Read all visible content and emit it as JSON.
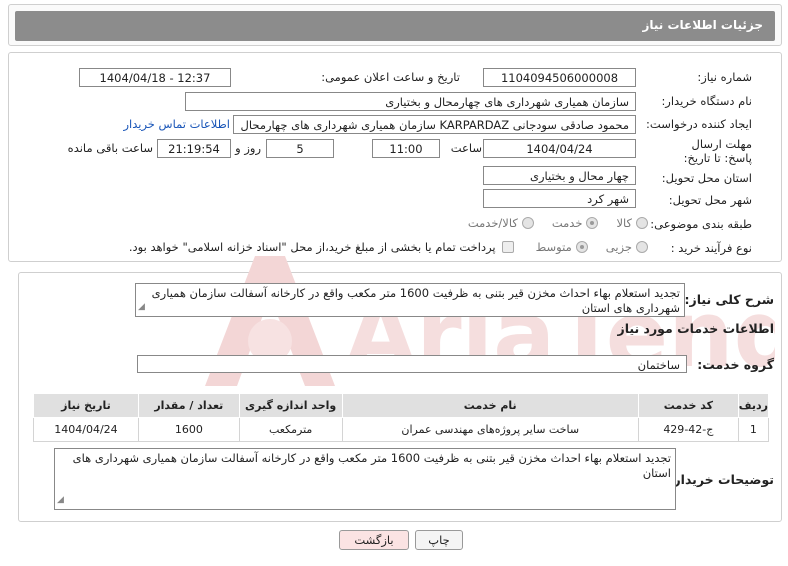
{
  "header": {
    "title": "جزئیات اطلاعات نیاز"
  },
  "info": {
    "need_number_label": "شماره نیاز:",
    "need_number": "1104094506000008",
    "announce_label": "تاریخ و ساعت اعلان عمومی:",
    "announce_value": "1404/04/18 - 12:37",
    "buyer_org_label": "نام دستگاه خریدار:",
    "buyer_org": "سازمان همیاری شهرداری های چهارمحال و بختیاری",
    "creator_label": "ایجاد کننده درخواست:",
    "creator": "محمود صادقی سودجانی KARPARDAZ سازمان همیاری شهرداری های چهارمحال",
    "contact_link": "اطلاعات تماس خریدار",
    "deadline_label": "مهلت ارسال پاسخ: تا تاریخ:",
    "deadline_date": "1404/04/24",
    "time_label": "ساعت",
    "deadline_time": "11:00",
    "days_value": "5",
    "days_label": "روز و",
    "remaining_time": "21:19:54",
    "remaining_label": "ساعت باقی مانده",
    "province_label": "استان محل تحویل:",
    "province": "چهار محال و بختیاری",
    "city_label": "شهر محل تحویل:",
    "city": "شهر کرد",
    "category_label": "طبقه بندی موضوعی:",
    "category_options": [
      "کالا",
      "خدمت",
      "کالا/خدمت"
    ],
    "category_selected": "خدمت",
    "process_label": "نوع فرآیند خرید :",
    "process_options": [
      "جزیی",
      "متوسط"
    ],
    "process_selected": "متوسط",
    "payment_note": "پرداخت تمام یا بخشی از مبلغ خرید،از محل \"اسناد خزانه اسلامی\" خواهد بود."
  },
  "summary": {
    "label": "شرح کلی نیاز:",
    "text": "تجدید استعلام بهاء احداث مخزن قیر بتنی به ظرفیت 1600 متر مکعب واقع در کارخانه آسفالت سازمان همیاری شهرداری های استان"
  },
  "services": {
    "section_title": "اطلاعات خدمات مورد نیاز",
    "group_label": "گروه خدمت:",
    "group_value": "ساختمان",
    "columns": [
      "ردیف",
      "کد خدمت",
      "نام خدمت",
      "واحد اندازه گیری",
      "تعداد / مقدار",
      "تاریخ نیاز"
    ],
    "rows": [
      [
        "1",
        "ج-42-429",
        "ساخت سایر پروژه‌های مهندسی عمران",
        "مترمکعب",
        "1600",
        "1404/04/24"
      ]
    ]
  },
  "buyer_notes": {
    "label": "توضیحات خریدار:",
    "text": "تجدید استعلام بهاء احداث مخزن قیر بتنی به ظرفیت 1600 متر مکعب واقع در کارخانه آسفالت سازمان همیاری شهرداری های استان"
  },
  "buttons": {
    "print": "چاپ",
    "back": "بازگشت"
  },
  "watermark": {
    "text": "AriaTender.neT"
  },
  "colors": {
    "header_bg": "#8c8c8c",
    "link": "#1a56b8",
    "back_button_bg": "#fbe3e3",
    "watermark": "#f3d6d6"
  }
}
